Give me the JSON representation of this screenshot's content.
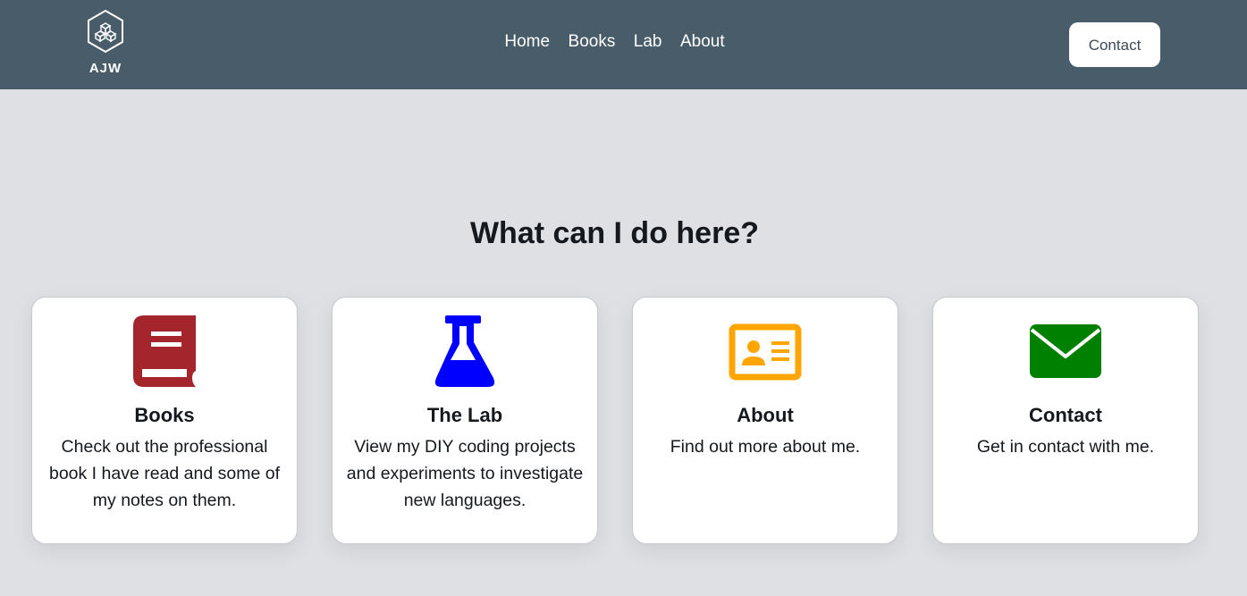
{
  "header": {
    "logo_text": "AJW",
    "nav": [
      {
        "label": "Home"
      },
      {
        "label": "Books"
      },
      {
        "label": "Lab"
      },
      {
        "label": "About"
      }
    ],
    "contact_label": "Contact"
  },
  "main": {
    "title": "What can I do here?",
    "cards": [
      {
        "icon": "book-icon",
        "icon_color": "#a4262c",
        "title": "Books",
        "description": "Check out the professional book I have read and some of my notes on them."
      },
      {
        "icon": "flask-icon",
        "icon_color": "#0000ff",
        "title": "The Lab",
        "description": "View my DIY coding projects and experiments to investigate new languages."
      },
      {
        "icon": "id-card-icon",
        "icon_color": "#ffa500",
        "title": "About",
        "description": "Find out more about me."
      },
      {
        "icon": "envelope-icon",
        "icon_color": "#008000",
        "title": "Contact",
        "description": "Get in contact with me."
      }
    ]
  },
  "colors": {
    "header_bg": "#495c69",
    "page_bg": "#dfe0e4",
    "card_bg": "#ffffff"
  }
}
